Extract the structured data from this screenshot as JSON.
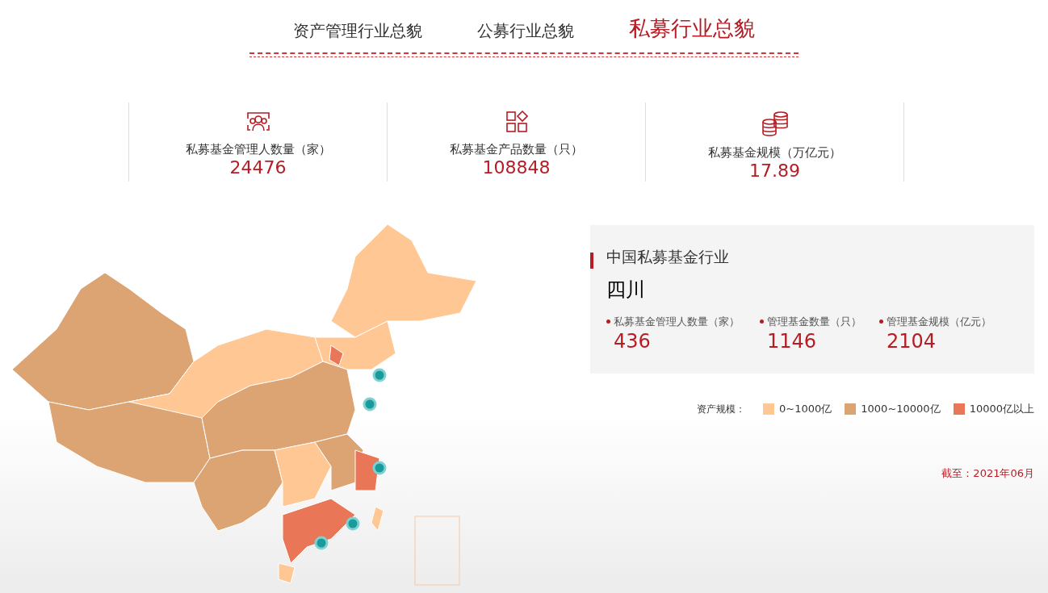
{
  "tabs": [
    {
      "label": "资产管理行业总貌",
      "selected": false
    },
    {
      "label": "公募行业总貌",
      "selected": false
    },
    {
      "label": "私募行业总貌",
      "selected": true
    }
  ],
  "stats": [
    {
      "kind": "people",
      "label": "私募基金管理人数量（家）",
      "value": "24476"
    },
    {
      "kind": "grid",
      "label": "私募基金产品数量（只）",
      "value": "108848"
    },
    {
      "kind": "coins",
      "label": "私募基金规模（万亿元）",
      "value": "17.89"
    }
  ],
  "info_panel": {
    "title": "中国私募基金行业",
    "region": "四川",
    "metrics": [
      {
        "label": "私募基金管理人数量（家）",
        "value": "436"
      },
      {
        "label": "管理基金数量（只）",
        "value": "1146"
      },
      {
        "label": "管理基金规模（亿元）",
        "value": "2104"
      }
    ]
  },
  "legend": {
    "title": "资产规模：",
    "items": [
      {
        "label": "0~1000亿",
        "color": "#fec794"
      },
      {
        "label": "1000~10000亿",
        "color": "#dca473"
      },
      {
        "label": "10000亿以上",
        "color": "#e87657"
      }
    ]
  },
  "as_of": "截至：2021年06月"
}
